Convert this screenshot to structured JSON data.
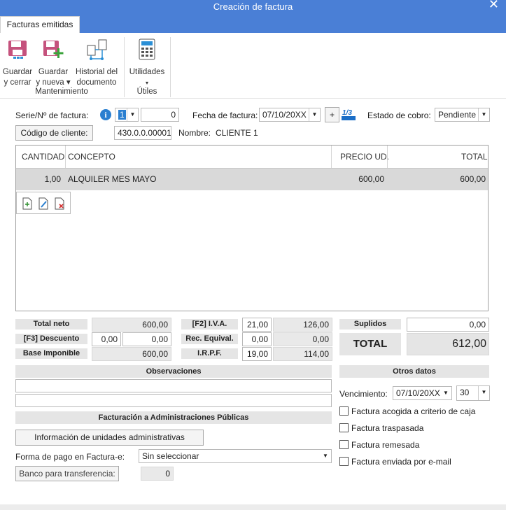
{
  "window": {
    "title": "Creación de factura"
  },
  "ribbon": {
    "tab": "Facturas emitidas",
    "buttons": [
      {
        "l1": "Guardar",
        "l2": "y cerrar"
      },
      {
        "l1": "Guardar",
        "l2": "y nueva ▾"
      },
      {
        "l1": "Historial del",
        "l2": "documento"
      },
      {
        "l1": "Utilidades",
        "l2": "▾"
      }
    ],
    "groups": [
      "Mantenimiento",
      "Útiles"
    ]
  },
  "header": {
    "serie_label": "Serie/Nº de factura:",
    "serie_value": "1",
    "numero_value": "0",
    "fecha_label": "Fecha de factura:",
    "fecha_value": "07/10/20XX",
    "plus_label": "+",
    "estado_label": "Estado de cobro:",
    "estado_value": "Pendiente",
    "cliente_button": "Código de cliente:",
    "cliente_value": "430.0.0.00001",
    "nombre_label": "Nombre:",
    "nombre_value": "CLIENTE 1"
  },
  "lines": {
    "columns": [
      "CANTIDAD",
      "CONCEPTO",
      "PRECIO UD.",
      "TOTAL"
    ],
    "rows": [
      {
        "cantidad": "1,00",
        "concepto": "ALQUILER MES MAYO",
        "precio": "600,00",
        "total": "600,00"
      }
    ]
  },
  "totals": {
    "total_neto_label": "Total neto",
    "total_neto": "600,00",
    "descuento_label": "[F3] Descuento",
    "descuento_pct": "0,00",
    "descuento": "0,00",
    "base_label": "Base Imponible",
    "base": "600,00",
    "iva_label": "[F2] I.V.A.",
    "iva_pct": "21,00",
    "iva": "126,00",
    "rec_label": "Rec. Equival.",
    "rec_pct": "0,00",
    "rec": "0,00",
    "irpf_label": "I.R.P.F.",
    "irpf_pct": "19,00",
    "irpf": "114,00",
    "suplidos_label": "Suplidos",
    "suplidos": "0,00",
    "total_label": "TOTAL",
    "total": "612,00"
  },
  "observaciones": {
    "label": "Observaciones"
  },
  "otros": {
    "label": "Otros datos",
    "vencimiento_label": "Vencimiento:",
    "vencimiento_value": "07/10/20XX",
    "dias_value": "30",
    "checks": [
      "Factura acogida a criterio de caja",
      "Factura traspasada",
      "Factura remesada",
      "Factura enviada por e-mail"
    ]
  },
  "facturacion": {
    "label": "Facturación a Administraciones Públicas",
    "info_button": "Información de unidades administrativas",
    "forma_pago_label": "Forma de pago en Factura-e:",
    "forma_pago_value": "Sin seleccionar",
    "banco_button": "Banco para transferencia:",
    "banco_value": "0"
  }
}
